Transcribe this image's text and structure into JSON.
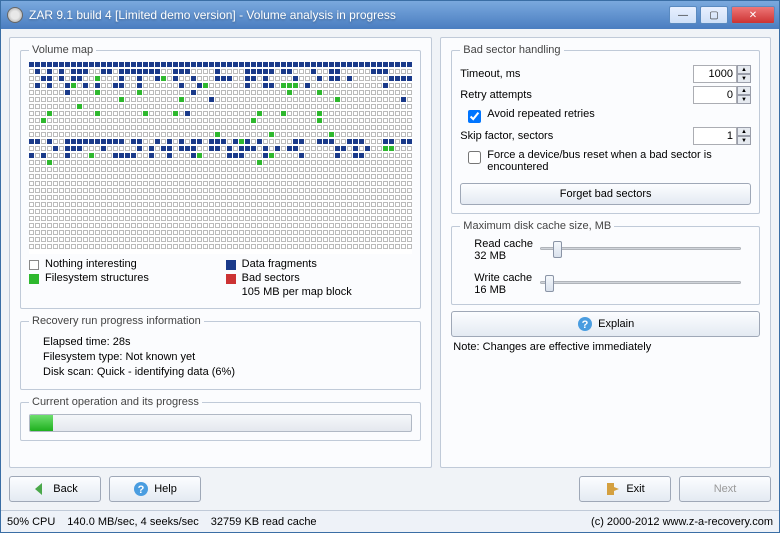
{
  "window": {
    "title": "ZAR 9.1 build 4 [Limited demo version] - Volume analysis in progress"
  },
  "volumeMap": {
    "groupLabel": "Volume map",
    "legend": {
      "nothing": "Nothing interesting",
      "fs": "Filesystem structures",
      "data": "Data fragments",
      "bad": "Bad sectors",
      "blocksize": "105 MB per map block"
    }
  },
  "recovery": {
    "groupLabel": "Recovery run progress information",
    "elapsedLabel": "Elapsed time:",
    "elapsedValue": "28s",
    "fsTypeLabel": "Filesystem type:",
    "fsTypeValue": "Not known yet",
    "scanLabel": "Disk scan:",
    "scanValue": "Quick - identifying data (6%)"
  },
  "currentOp": {
    "groupLabel": "Current operation and its progress",
    "percent": 6
  },
  "bad": {
    "groupLabel": "Bad sector handling",
    "timeoutLabel": "Timeout, ms",
    "timeoutValue": "1000",
    "retryLabel": "Retry attempts",
    "retryValue": "0",
    "avoidLabel": "Avoid repeated retries",
    "avoidChecked": true,
    "skipLabel": "Skip factor, sectors",
    "skipValue": "1",
    "forceLabel": "Force a device/bus reset when a bad sector is encountered",
    "forceChecked": false,
    "forgetBtn": "Forget bad sectors"
  },
  "cache": {
    "groupLabel": "Maximum disk cache size, MB",
    "readLabel": "Read cache",
    "readValue": "32 MB",
    "writeLabel": "Write cache",
    "writeValue": "16 MB"
  },
  "explainBtn": "Explain",
  "changesNote": "Note: Changes are effective immediately",
  "buttons": {
    "back": "Back",
    "help": "Help",
    "exit": "Exit",
    "next": "Next"
  },
  "status": {
    "cpu": "50% CPU",
    "io": "140.0 MB/sec, 4 seeks/sec",
    "cache": "32759 KB read cache",
    "copyright": "(c) 2000-2012 www.z-a-recovery.com"
  },
  "mapPattern": [
    "dddddddddddddddddddddddddddddddddddddddddddddddddddddddddddddddd",
    "ededededddeeddedddddddeedddeeeedeeeedddddeddeeedeeddeeeeedddeeee",
    "eeddededdeefeeedeedeedfedeedeeedddeeddedeeeedeeededdedeeeeeedddd",
    "ededeedfededeeddeedeeeeeedeedfeeeeeedeeddefffedeeeeeeeeeeeedeeee",
    "eeeeeedeeeefeeeeeefeeeeeeeedeeeeeeeeeeeeeeefeeeefeeeeeeeeeeeeeee",
    "eeeeeeeeeeeeeeefeeeeeeeeefeeeedeeeeeeeeeeeeeeeeeeeefeeeeeeeeeede",
    "eeeeeeeefeeeeeeeeeeeeeeeeeeeeeeeeeeeeeeeeeeeeeeeeeeeeeeeeeeeeeee",
    "eeefeeeeeeefeeeeeeefeeeefedeeeeeeeeeeefeeefeeeeefeeeeeeeeeeeeeee",
    "eefeeeeeeeeeeeeeeeeeeeeeeeeeeeeeeeeeefeeeeeeeeeefeeeeeeeeeeeeeee",
    "eeeeeeeeeeeeeeeeeeeeeeeeeeeeeeeeeeeeeeeeeeeeeeeeeeeeeeeeeeeeeeee",
    "eeeeeeeeeeeeeeeeeeeeeeeeeeeeeeefeeeeeeeefeeeeeeeeefeeeeeeeeeeeee",
    "ddedeeddddddddddeddeededededdedddedfdedeeeeeddeedddeedddeeeddedd",
    "eeeededddeeedeeeeedededdedddeeddededddedededdeeeeeeddededeeffeee",
    "dedeeedeeefeeeddddeedeedeeedfeeeedddeeedfeeeedeeeeedeeddeeeeeeee",
    "eeefeeeeeeeeeeeeeeeeeeeeeeeeeeeeeeeeeefeeeeeeeeeeeeeeeeeeeeeeeee",
    "eeeeeeeeeeeeeeeeeeeeeeeeeeeeeeeeeeeeeeeeeeeeeeeeeeeeeeeeeeeeeeee",
    "eeeeeeeeeeeeeeeeeeeeeeeeeeeeeeeeeeeeeeeeeeeeeeeeeeeeeeeeeeeeeeee",
    "eeeeeeeeeeeeeeeeeeeeeeeeeeeeeeeeeeeeeeeeeeeeeeeeeeeeeeeeeeeeeeee",
    "eeeeeeeeeeeeeeeeeeeeeeeeeeeeeeeeeeeeeeeeeeeeeeeeeeeeeeeeeeeeeeee",
    "eeeeeeeeeeeeeeeeeeeeeeeeeeeeeeeeeeeeeeeeeeeeeeeeeeeeeeeeeeeeeeee",
    "eeeeeeeeeeeeeeeeeeeeeeeeeeeeeeeeeeeeeeeeeeeeeeeeeeeeeeeeeeeeeeee",
    "eeeeeeeeeeeeeeeeeeeeeeeeeeeeeeeeeeeeeeeeeeeeeeeeeeeeeeeeeeeeeeee",
    "eeeeeeeeeeeeeeeeeeeeeeeeeeeeeeeeeeeeeeeeeeeeeeeeeeeeeeeeeeeeeeee",
    "eeeeeeeeeeeeeeeeeeeeeeeeeeeeeeeeeeeeeeeeeeeeeeeeeeeeeeeeeeeeeeee",
    "eeeeeeeeeeeeeeeeeeeeeeeeeeeeeeeeeeeeeeeeeeeeeeeeeeeeeeeeeeeeeeee",
    "eeeeeeeeeeeeeeeeeeeeeeeeeeeeeeeeeeeeeeeeeeeeeeeeeeeeeeeeeeeeeeee",
    "eeeeeeeeeeeeeeeeeeeeeeeeeeeeeeeeeeeeeeeeeeeeeeeeeeeeeeeeeeeeeeee"
  ]
}
